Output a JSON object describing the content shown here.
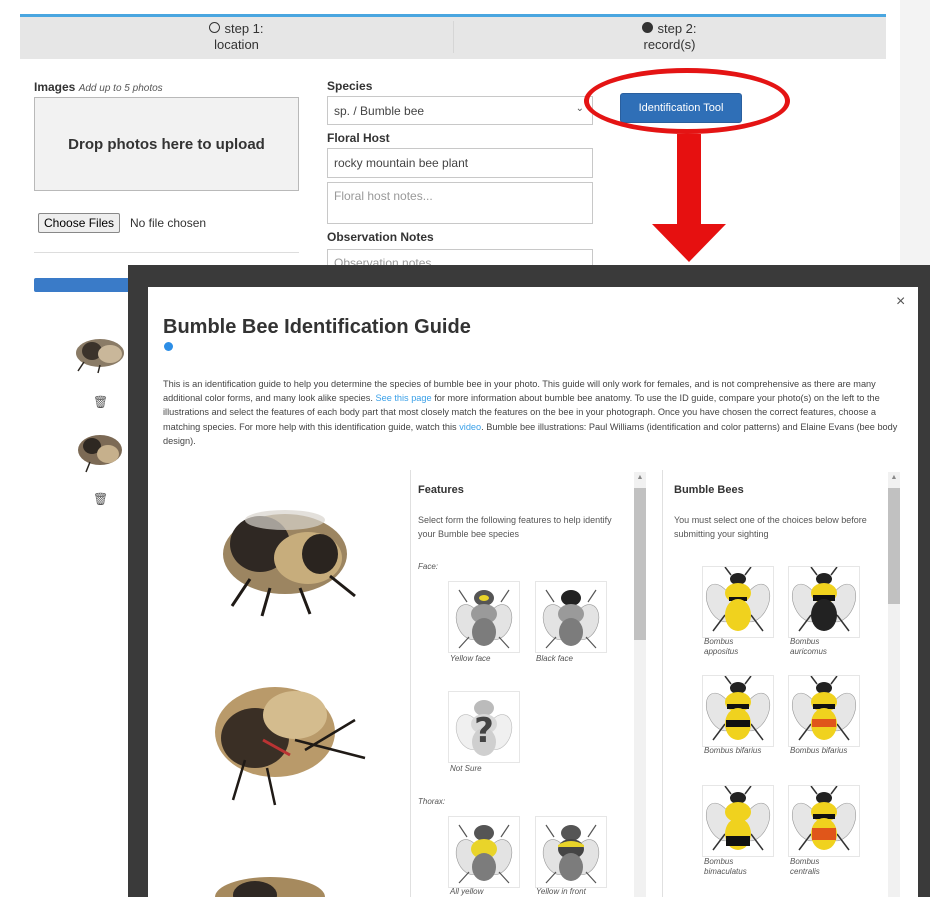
{
  "steps": [
    {
      "label_line1": "step 1:",
      "label_line2": "location",
      "state": "incomplete"
    },
    {
      "label_line1": "step 2:",
      "label_line2": "record(s)",
      "state": "active"
    }
  ],
  "form": {
    "images_label": "Images",
    "images_hint": "Add up to 5 photos",
    "dropzone_text": "Drop photos here to upload",
    "choose_files_label": "Choose Files",
    "no_file_text": "No file chosen",
    "species_label": "Species",
    "species_value": "sp. / Bumble bee",
    "floral_host_label": "Floral Host",
    "floral_host_value": "rocky mountain bee plant",
    "floral_notes_placeholder": "Floral host notes...",
    "observation_label": "Observation Notes",
    "observation_placeholder": "Observation notes..."
  },
  "id_tool_button": "Identification Tool",
  "modal": {
    "close_glyph": "×",
    "title": "Bumble Bee Identification Guide",
    "desc_part1": "This is an identification guide to help you determine the species of bumble bee in your photo. This guide will only work for females, and is not comprehensive as there are many additional color forms, and many look alike species. ",
    "desc_link1": "See this page",
    "desc_part2": " for more information about bumble bee anatomy. To use the ID guide, compare your photo(s) on the left to the illustrations and select the features of each body part that most closely match the features on the bee in your photograph. Once you have chosen the correct features, choose a matching species. For more help with this identification guide, watch this ",
    "desc_link2": "video",
    "desc_part3": ". Bumble bee illustrations: Paul Williams (identification and color patterns) and Elaine Evans (bee body design).",
    "features": {
      "title": "Features",
      "intro": "Select form the following features to help identify your Bumble bee species",
      "face_label": "Face:",
      "face_options": [
        "Yellow face",
        "Black face",
        "Not Sure"
      ],
      "thorax_label": "Thorax:",
      "thorax_options": [
        "All yellow",
        "Yellow in front"
      ]
    },
    "bees": {
      "title": "Bumble Bees",
      "intro": "You must select one of the choices below before submitting your sighting",
      "items": [
        {
          "line1": "Bombus",
          "line2": "appositus"
        },
        {
          "line1": "Bombus",
          "line2": "auricomus"
        },
        {
          "line1": "Bombus bifarius",
          "line2": ""
        },
        {
          "line1": "Bombus bifarius",
          "line2": ""
        },
        {
          "line1": "Bombus",
          "line2": "bimaculatus"
        },
        {
          "line1": "Bombus",
          "line2": "centralis"
        }
      ]
    }
  },
  "colors": {
    "accent_blue": "#2f6fb7",
    "annotation_red": "#e41414",
    "link_blue": "#3aa0e8",
    "step_border": "#4aa6e0"
  },
  "icons": [
    "trash-icon",
    "close-icon",
    "info-icon",
    "chevron-down-icon"
  ]
}
